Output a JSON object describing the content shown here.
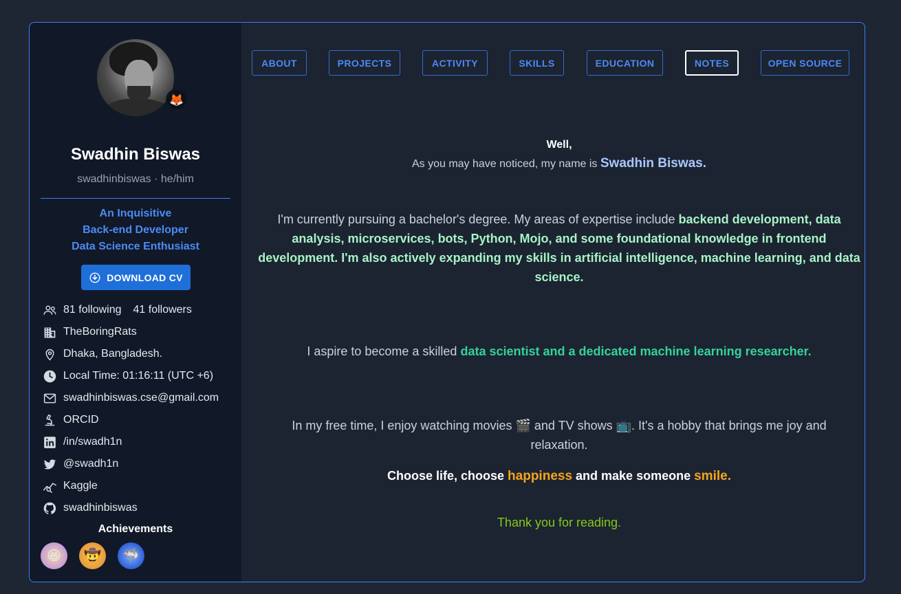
{
  "profile": {
    "name": "Swadhin Biswas",
    "handle": "swadhinbiswas · he/him",
    "roles": [
      "An Inquisitive",
      "Back-end Developer",
      "Data Science Enthusiast"
    ],
    "download_cv": "DOWNLOAD CV",
    "following": "81 following",
    "followers": "41 followers",
    "organization": "TheBoringRats",
    "location": "Dhaka, Bangladesh.",
    "local_time": "Local Time: 01:16:11 (UTC +6)",
    "email": "swadhinbiswas.cse@gmail.com",
    "orcid": "ORCID",
    "linkedin": "/in/swadh1n",
    "twitter": "@swadh1n",
    "kaggle": "Kaggle",
    "github": "swadhinbiswas",
    "achievements_title": "Achievements"
  },
  "tabs": [
    "ABOUT",
    "PROJECTS",
    "ACTIVITY",
    "SKILLS",
    "EDUCATION",
    "NOTES",
    "OPEN SOURCE"
  ],
  "active_tab": "NOTES",
  "content": {
    "well": "Well,",
    "intro": "As you may have noticed, my name is ",
    "intro_name": "Swadhin Biswas.",
    "degree_start": "I'm currently pursuing a bachelor's degree. My areas of expertise include ",
    "degree_highlight": "backend development, data analysis, microservices, bots, Python, Mojo, and some foundational knowledge in frontend development. I'm also actively expanding my skills in artificial intelligence, machine learning, and data science.",
    "aspire_start": "I aspire to become a skilled ",
    "aspire_highlight": "data scientist and a dedicated machine learning researcher.",
    "free_time": "In my free time, I enjoy watching movies 🎬 and TV shows 📺. It's a hobby that brings me joy and relaxation.",
    "choose_1": "Choose life, choose ",
    "choose_happiness": "happiness",
    "choose_2": " and make someone ",
    "choose_smile": "smile.",
    "thanks": "Thank you for reading."
  },
  "colors": {
    "accent": "#3b82f6",
    "highlight_green": "#a7f3c6",
    "highlight_teal": "#34d399",
    "highlight_orange": "#f4a61b",
    "thanks_green": "#84cc16"
  }
}
